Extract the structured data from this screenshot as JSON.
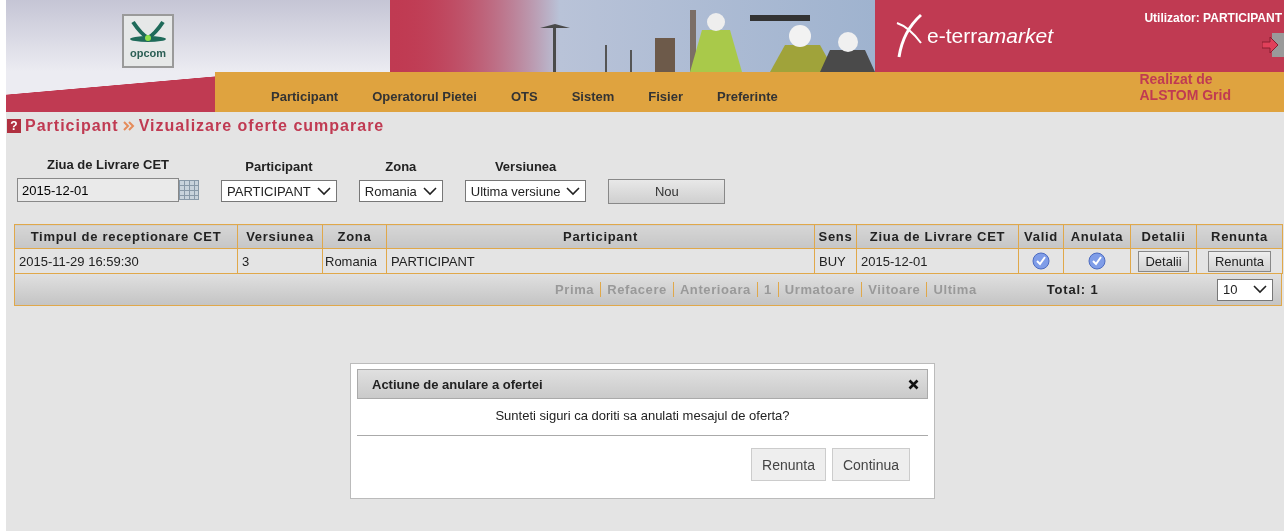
{
  "header": {
    "logo_text": "opcom",
    "brand": {
      "plain": "e-terra",
      "italic": "market"
    },
    "user": "Utilizator: PARTICIPANT",
    "credit": [
      "Realizat de",
      "ALSTOM Grid"
    ],
    "nav": [
      {
        "label": "Participant"
      },
      {
        "label": "Operatorul Pietei"
      },
      {
        "label": "OTS"
      },
      {
        "label": "Sistem"
      },
      {
        "label": "Fisier"
      },
      {
        "label": "Preferinte"
      }
    ]
  },
  "breadcrumb": {
    "help": "?",
    "items": [
      "Participant",
      "Vizualizare oferte cumparare"
    ]
  },
  "filters": {
    "delivery_day": {
      "label": "Ziua de Livrare CET",
      "value": "2015-12-01"
    },
    "selects": [
      {
        "label": "Participant",
        "value": "PARTICIPANT"
      },
      {
        "label": "Zona",
        "value": "Romania"
      },
      {
        "label": "Versiunea",
        "value": "Ultima versiune"
      }
    ],
    "new_button": "Nou"
  },
  "table": {
    "columns": [
      "Timpul de receptionare CET",
      "Versiunea",
      "Zona",
      "Participant",
      "Sens",
      "Ziua de Livrare CET",
      "Valid",
      "Anulata",
      "Detalii",
      "Renunta"
    ],
    "rows": [
      {
        "received": "2015-11-29 16:59:30",
        "version": "3",
        "zone": "Romania",
        "participant": "PARTICIPANT",
        "direction": "BUY",
        "delivery_day": "2015-12-01",
        "valid": true,
        "cancelled": true,
        "details_button": "Detalii",
        "cancel_button": "Renunta"
      }
    ],
    "pager": {
      "links": [
        {
          "label": "Prima",
          "disabled": true
        },
        {
          "label": "Refacere",
          "disabled": true
        },
        {
          "label": "Anterioara",
          "disabled": true
        },
        {
          "label": "1",
          "disabled": true
        },
        {
          "label": "Urmatoare",
          "disabled": true
        },
        {
          "label": "Viitoare",
          "disabled": true
        },
        {
          "label": "Ultima",
          "disabled": true
        }
      ],
      "total": "Total: 1",
      "page_size": "10"
    }
  },
  "dialog": {
    "title": "Actiune de anulare a ofertei",
    "message": "Sunteti siguri ca doriti sa anulati mesajul de oferta?",
    "buttons": [
      "Renunta",
      "Continua"
    ]
  }
}
